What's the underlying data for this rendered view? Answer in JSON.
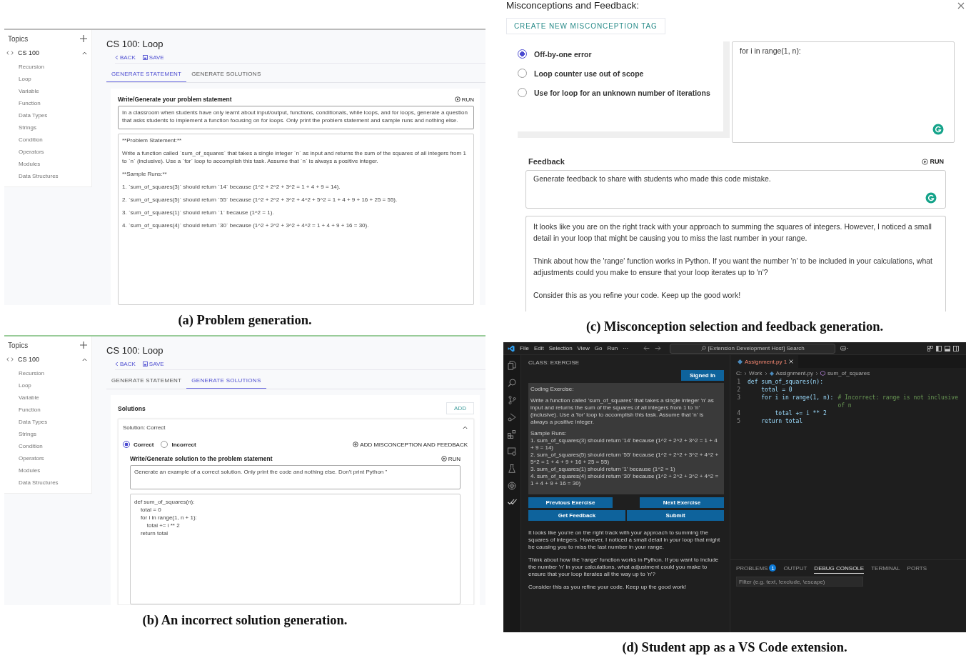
{
  "problem_generation": {
    "sidebar": {
      "title": "Topics",
      "course": {
        "label": "CS 100",
        "expanded": true
      },
      "topics": [
        "Recursion",
        "Loop",
        "Variable",
        "Function",
        "Data Types",
        "Strings",
        "Condition",
        "Operators",
        "Modules",
        "Data Structures"
      ]
    },
    "page_title": "CS 100: Loop",
    "toolbar": [
      "BACK",
      "SAVE"
    ],
    "tabs": [
      {
        "label": "GENERATE STATEMENT",
        "selected": true
      },
      {
        "label": "GENERATE SOLUTIONS",
        "selected": false
      }
    ],
    "prompt_label": "Write/Generate your problem statement",
    "run_label": "RUN",
    "prompt": "In a classroom when students have only learnt about input/output, functions, conditionals, while loops, and for loops, generate a question that asks students to implement a function focusing on for loops. Only print the problem statement and sample runs and nothing else.",
    "output_lines": [
      "**Problem Statement:**",
      "Write a function called `sum_of_squares` that takes a single integer `n` as input and returns the sum of the squares of all integers from 1 to `n` (inclusive). Use a `for` loop to accomplish this task. Assume that `n` is always a positive integer.",
      "**Sample Runs:**",
      "1. `sum_of_squares(3)` should return `14` because  (1^2 + 2^2 + 3^2 = 1 + 4 + 9 = 14).",
      "2. `sum_of_squares(5)` should return `55` because (1^2 + 2^2 + 3^2 + 4^2 + 5^2 = 1 + 4 + 9 + 16 + 25 = 55).",
      "3. `sum_of_squares(1)` should return `1` because (1^2 = 1).",
      "4. `sum_of_squares(4)` should return `30` because (1^2 + 2^2 + 3^2 + 4^2 = 1 + 4 + 9 + 16 = 30)."
    ],
    "caption": "(a) Problem generation."
  },
  "solution_generation": {
    "sidebar": {
      "title": "Topics",
      "course": {
        "label": "CS 100",
        "expanded": true
      },
      "topics": [
        "Recursion",
        "Loop",
        "Variable",
        "Function",
        "Data Types",
        "Strings",
        "Condition",
        "Operators",
        "Modules",
        "Data Structures"
      ]
    },
    "page_title": "CS 100: Loop",
    "toolbar": [
      "BACK",
      "SAVE"
    ],
    "tabs": [
      {
        "label": "GENERATE STATEMENT",
        "selected": false
      },
      {
        "label": "GENERATE SOLUTIONS",
        "selected": true
      }
    ],
    "section_title": "Solutions",
    "add_button": "ADD",
    "solution_header": "Solution: Correct",
    "solution_expanded": true,
    "options": [
      {
        "label": "Correct",
        "selected": true
      },
      {
        "label": "Incorrect",
        "selected": false
      }
    ],
    "add_misconception": "ADD MISCONCEPTION AND FEEDBACK",
    "prompt_label": "Write/Generate solution to the problem statement",
    "run_label": "RUN",
    "prompt": "Generate an example of a correct solution. Only print the code and nothing else. Don't print Python \"",
    "code_lines": [
      "def sum_of_squares(n):",
      "    total = 0",
      "    for i in range(1, n + 1):",
      "        total += i ** 2",
      "    return total"
    ],
    "caption": "(b) An incorrect solution generation."
  },
  "misconception_feedback": {
    "title": "Misconceptions and Feedback:",
    "create_button": "CREATE NEW MISCONCEPTION TAG",
    "misconceptions": [
      {
        "label": "Off-by-one error",
        "selected": true
      },
      {
        "label": "Loop counter use out of scope",
        "selected": false
      },
      {
        "label": "Use for loop for an unknown number of iterations",
        "selected": false
      }
    ],
    "code": "for i in range(1, n):",
    "feedback_label": "Feedback",
    "run_label": "RUN",
    "feedback_prompt": "Generate feedback to share with students who made this code mistake.",
    "feedback_paragraphs": [
      "It looks like you are on the right track with your approach to summing the squares of integers. However, I noticed a small detail in your loop that might be causing you to miss the last number in your range.",
      "Think about how the 'range' function works in Python. If you want the number 'n' to be included in your calculations, what adjustments could you make to ensure that your loop iterates up to 'n'?",
      "Consider this as you refine your code. Keep up the good work!"
    ],
    "caption": "(c) Misconception selection and feedback generation."
  },
  "vscode_extension": {
    "menu": [
      "File",
      "Edit",
      "Selection",
      "View",
      "Go",
      "Run",
      "···"
    ],
    "search": "[Extension Development Host] Search",
    "panel_title": "CLASS: EXERCISE",
    "signed_in": "Signed In",
    "exercise_heading": "Coding Exercise:",
    "exercise_text": "Write a function called 'sum_of_squares' that takes a single integer 'n' as input and returns the sum of the squares of all integers from 1 to 'n' (inclusive). Use a 'for' loop to accomplish this task. Assume that 'n' is always a positive integer.",
    "sample_runs_heading": "Sample Runs:",
    "sample_runs": [
      "1. sum_of_squares(3) should return '14' because  (1^2 + 2^2 + 3^2 = 1 + 4 + 9 = 14)",
      "2. sum_of_squares(5) should return '55' because (1^2 + 2^2 + 3^2 + 4^2 + 5^2 = 1 + 4 + 9 + 16 + 25 = 55)",
      "3. sum_of_squares(1) should return '1' because (1^2 = 1)",
      "4. sum_of_squares(4) should return '30' because (1^2 + 2^2 + 3^2 + 4^2 = 1 + 4 + 9 + 16 = 30)"
    ],
    "buttons": [
      "Previous Exercise",
      "Next Exercise",
      "Get Feedback",
      "Submit"
    ],
    "feedback_paragraphs": [
      "It looks like you're on the right track with your approach to summing the squares of integers. However, I noticed a small detail in your loop that might be causing you to miss the last number in your range.",
      "Think about how the 'range' function works in Python. If you want to include the number 'n' in your calculations, what adjustment could you make to ensure that your loop iterates all the way up to 'n'?",
      "Consider this as you refine your code. Keep up the good work!"
    ],
    "editor_tab": "Assignment.py 1",
    "breadcrumbs": [
      "C:",
      "Work",
      "Assignment.py",
      "sum_of_squares"
    ],
    "code_lines": [
      {
        "number": "1",
        "code": "def sum_of_squares(n):"
      },
      {
        "number": "2",
        "code": "    total = 0"
      },
      {
        "number": "3",
        "code": "    for i in range(1, n):",
        "comment": "# Incorrect: range is not inclusive of n"
      },
      {
        "number": "4",
        "code": "        total += i ** 2"
      },
      {
        "number": "5",
        "code": "    return total"
      }
    ],
    "panel_tabs": [
      {
        "label": "PROBLEMS",
        "badge": "1",
        "selected": false
      },
      {
        "label": "OUTPUT",
        "selected": false
      },
      {
        "label": "DEBUG CONSOLE",
        "selected": true
      },
      {
        "label": "TERMINAL",
        "selected": false
      },
      {
        "label": "PORTS",
        "selected": false
      }
    ],
    "filter_placeholder": "Filter (e.g. text, !exclude, \\escape)",
    "caption": "(d) Student app as a VS Code extension."
  }
}
